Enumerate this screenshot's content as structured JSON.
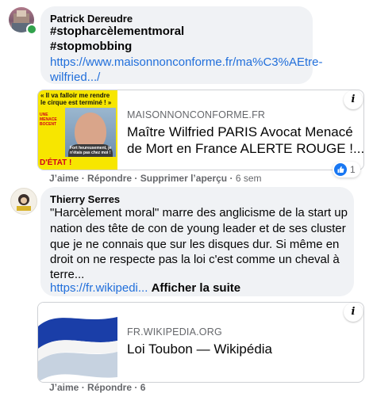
{
  "comment1": {
    "author": "Patrick Dereudre",
    "hashtag1": "#stopharcèlementmoral",
    "hashtag2": "#stopmobbing",
    "link_line1": "https://www.maisonnonconforme.fr/ma%C3%AEtre-",
    "link_line2": "wilfried.../",
    "preview": {
      "host": "MAISONNONCONFORME.FR",
      "title_line1": "Maître Wilfried PARIS Avocat Menacé",
      "title_line2": "de Mort en France ALERTE ROUGE !...",
      "thumb_line1": "« Il va falloir me rendre",
      "thumb_line2": "le cirque est terminé ! »",
      "thumb_side": "UNE MENACE BOCENT",
      "thumb_stamp": "D'ÉTAT !",
      "thumb_quote": "Fort heureusement, je n'étais pas chez moi !"
    },
    "actions": {
      "like": "J’aime",
      "reply": "Répondre",
      "remove_preview": "Supprimer l’aperçu",
      "time": "6 sem",
      "reaction_count": "1"
    }
  },
  "comment2": {
    "author": "Thierry Serres",
    "text_lines": [
      "\"Harcèlement moral\" marre des anglicisme de la start up",
      "nation des tête de con de young leader et de ses cluster",
      "que je ne connais que sur les disques dur. Si même en",
      "droit on ne respecte pas la loi c'est comme un cheval à",
      "terre..."
    ],
    "link": "https://fr.wikipedi...",
    "see_more": "Afficher la suite",
    "preview": {
      "host": "FR.WIKIPEDIA.ORG",
      "title": "Loi Toubon — Wikipédia"
    },
    "actions_partial": "J’aime · Répondre · 6"
  },
  "colors": {
    "link": "#216fdb",
    "bubble": "#f0f2f5",
    "like_blue": "#1877f2",
    "presence_green": "#31a24c",
    "thumb_yellow": "#f7e600"
  },
  "icons": [
    "info-icon",
    "like-reaction-icon",
    "online-status-icon"
  ]
}
